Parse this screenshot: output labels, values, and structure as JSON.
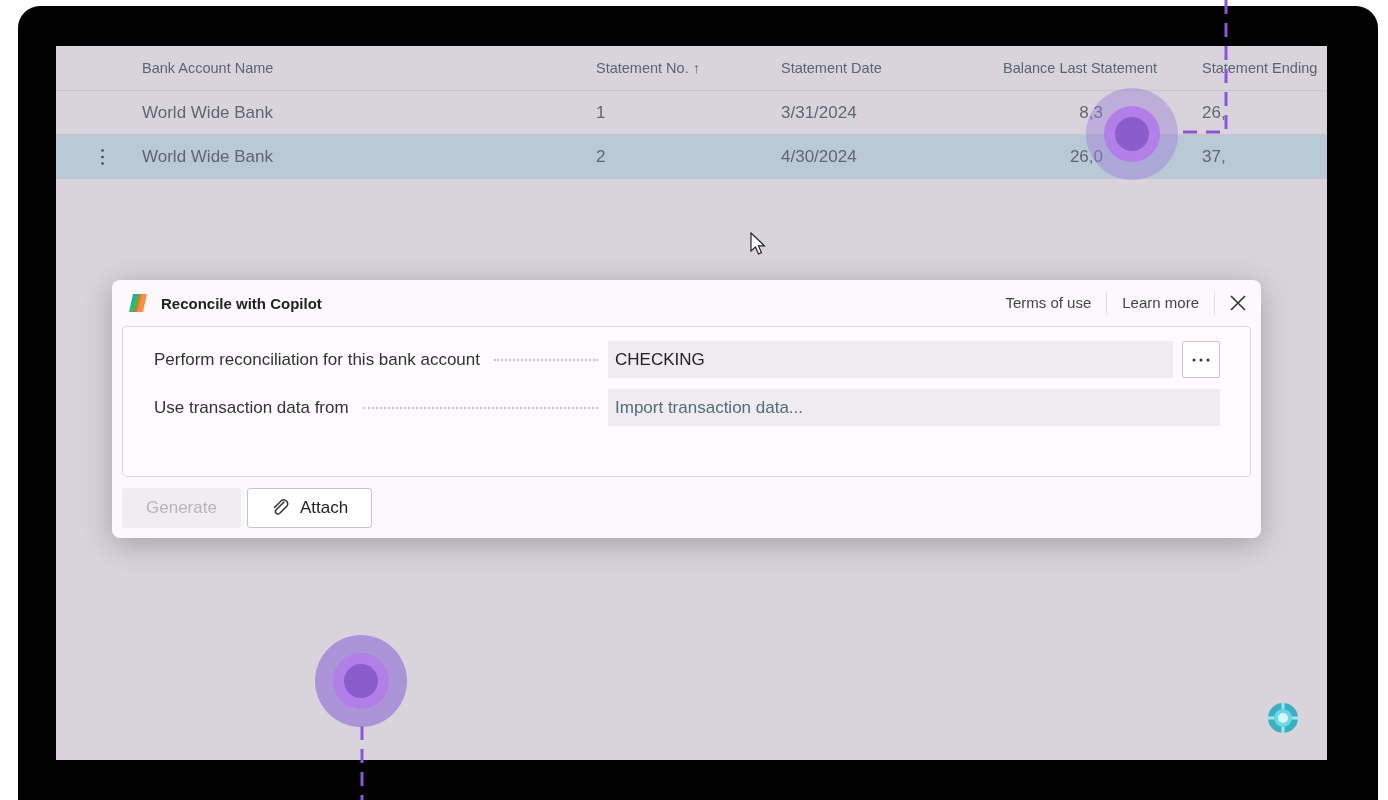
{
  "table": {
    "columns": [
      "Bank Account Name",
      "Statement No. ↑",
      "Statement Date",
      "Balance Last Statement",
      "Statement Ending"
    ],
    "rows": [
      {
        "selected": false,
        "cells": [
          "World Wide Bank",
          "1",
          "3/31/2024",
          {
            "start": "8,3"
          },
          "26,"
        ]
      },
      {
        "selected": true,
        "cells": [
          "World Wide Bank",
          "2",
          "4/30/2024",
          {
            "start": "26,0"
          },
          "37,"
        ]
      }
    ]
  },
  "dialog": {
    "title": "Reconcile with Copilot",
    "links": [
      "Terms of use",
      "Learn more"
    ],
    "fields": [
      {
        "kind": "lookup",
        "label": "Perform reconciliation for this bank account",
        "value": "CHECKING"
      },
      {
        "kind": "action",
        "label": "Use transaction data from",
        "placeholder": "Import transaction data..."
      }
    ],
    "buttons": [
      {
        "label": "Generate",
        "disabled": true,
        "kind": "plain"
      },
      {
        "label": "Attach",
        "disabled": false,
        "kind": "attach"
      }
    ]
  }
}
